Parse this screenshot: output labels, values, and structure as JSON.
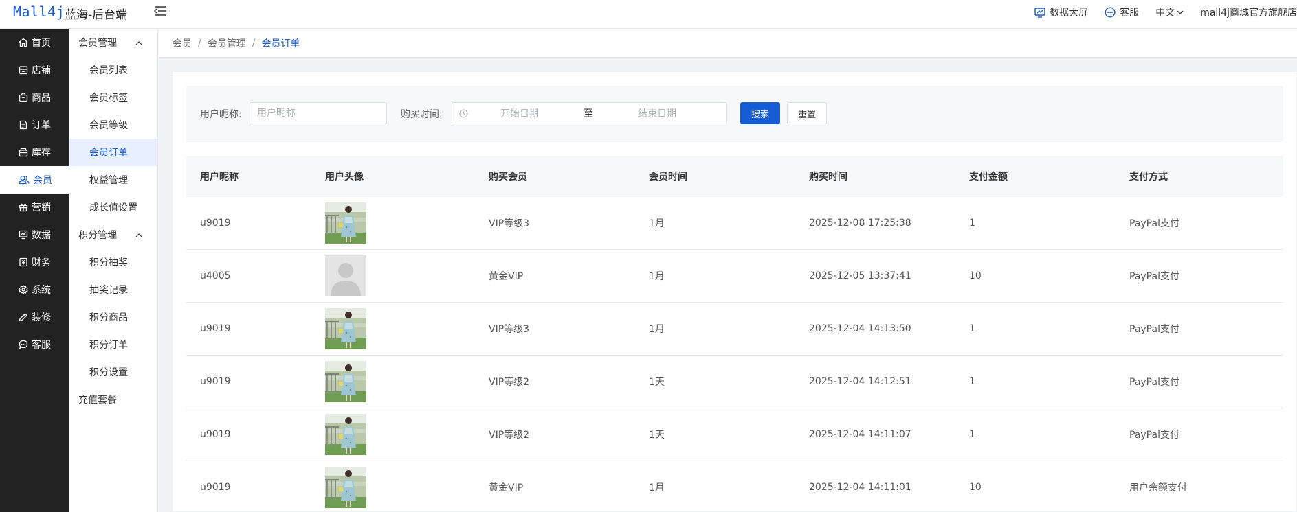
{
  "header": {
    "logo": "Mall4j",
    "site_name": "蓝海-后台端",
    "data_screen": "数据大屏",
    "customer_service": "客服",
    "language": "中文",
    "user": "mall4j商城官方旗舰店"
  },
  "sidebar": {
    "items": [
      {
        "label": "首页",
        "icon": "home-icon"
      },
      {
        "label": "店铺",
        "icon": "shop-icon"
      },
      {
        "label": "商品",
        "icon": "product-icon"
      },
      {
        "label": "订单",
        "icon": "order-icon"
      },
      {
        "label": "库存",
        "icon": "stock-icon"
      },
      {
        "label": "会员",
        "icon": "member-icon"
      },
      {
        "label": "营销",
        "icon": "gift-icon"
      },
      {
        "label": "数据",
        "icon": "chart-icon"
      },
      {
        "label": "财务",
        "icon": "finance-icon"
      },
      {
        "label": "系统",
        "icon": "gear-icon"
      },
      {
        "label": "装修",
        "icon": "decorate-icon"
      },
      {
        "label": "客服",
        "icon": "chat-icon"
      }
    ],
    "active": "会员"
  },
  "submenu": {
    "group1": "会员管理",
    "group1_items": [
      "会员列表",
      "会员标签",
      "会员等级",
      "会员订单",
      "权益管理",
      "成长值设置"
    ],
    "group2": "积分管理",
    "group2_items": [
      "积分抽奖",
      "抽奖记录",
      "积分商品",
      "积分订单",
      "积分设置"
    ],
    "recharge": "充值套餐",
    "active": "会员订单"
  },
  "breadcrumb": [
    "会员",
    "会员管理",
    "会员订单"
  ],
  "search": {
    "nickname_label": "用户昵称:",
    "nickname_placeholder": "用户昵称",
    "time_label": "购买时间:",
    "start_placeholder": "开始日期",
    "range_separator": "至",
    "end_placeholder": "结束日期",
    "search_button": "搜索",
    "reset_button": "重置"
  },
  "table": {
    "columns": [
      "用户昵称",
      "用户头像",
      "购买会员",
      "会员时间",
      "购买时间",
      "支付金额",
      "支付方式"
    ],
    "rows": [
      {
        "nickname": "u9019",
        "avatar": "photo",
        "level": "VIP等级3",
        "duration": "1月",
        "time": "2025-12-08 17:25:38",
        "amount": "1",
        "pay": "PayPal支付"
      },
      {
        "nickname": "u4005",
        "avatar": "default",
        "level": "黄金VIP",
        "duration": "1月",
        "time": "2025-12-05 13:37:41",
        "amount": "10",
        "pay": "PayPal支付"
      },
      {
        "nickname": "u9019",
        "avatar": "photo",
        "level": "VIP等级3",
        "duration": "1月",
        "time": "2025-12-04 14:13:50",
        "amount": "1",
        "pay": "PayPal支付"
      },
      {
        "nickname": "u9019",
        "avatar": "photo",
        "level": "VIP等级2",
        "duration": "1天",
        "time": "2025-12-04 14:12:51",
        "amount": "1",
        "pay": "PayPal支付"
      },
      {
        "nickname": "u9019",
        "avatar": "photo",
        "level": "VIP等级2",
        "duration": "1天",
        "time": "2025-12-04 14:11:07",
        "amount": "1",
        "pay": "PayPal支付"
      },
      {
        "nickname": "u9019",
        "avatar": "photo",
        "level": "黄金VIP",
        "duration": "1月",
        "time": "2025-12-04 14:11:01",
        "amount": "10",
        "pay": "用户余额支付"
      }
    ]
  },
  "colors": {
    "primary": "#155bd4",
    "sidebar_bg": "#222222",
    "active_sub_bg": "#e8efff"
  }
}
